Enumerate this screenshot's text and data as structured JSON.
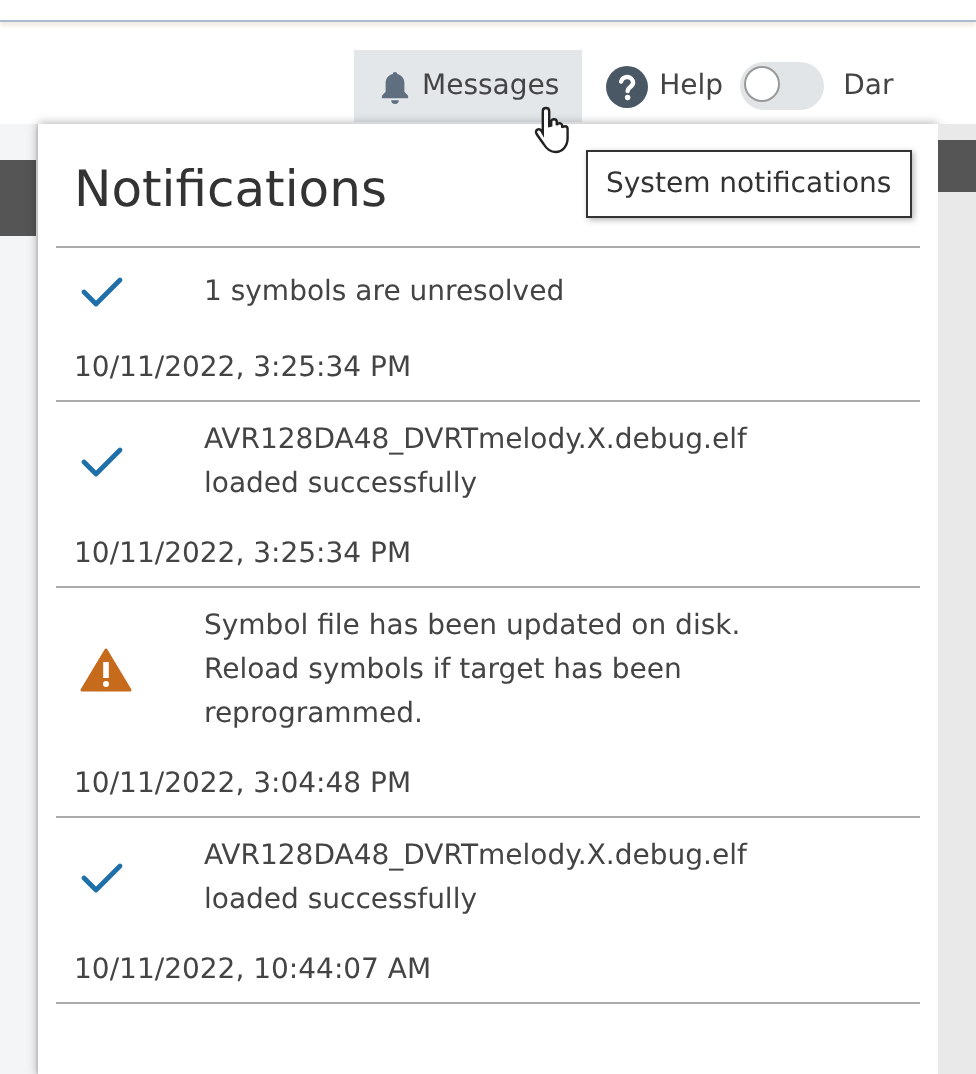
{
  "toolbar": {
    "messages_button": {
      "label": "Messages",
      "selected": true
    },
    "help_button": {
      "label": "Help"
    },
    "dark_toggle": {
      "label": "Dar",
      "on": false
    }
  },
  "tooltip": "System notifications",
  "notifications": {
    "title": "Notifications",
    "items": [
      {
        "kind": "success",
        "message": "1 symbols are unresolved",
        "time": "10/11/2022, 3:25:34 PM"
      },
      {
        "kind": "success",
        "message": "AVR128DA48_DVRTmelody.X.debug.elf loaded successfully",
        "time": "10/11/2022, 3:25:34 PM"
      },
      {
        "kind": "warning",
        "message": "Symbol file has been updated on disk. Reload symbols if target has been reprogrammed.",
        "time": "10/11/2022, 3:04:48 PM"
      },
      {
        "kind": "success",
        "message": "AVR128DA48_DVRTmelody.X.debug.elf loaded successfully",
        "time": "10/11/2022, 10:44:07 AM"
      }
    ]
  }
}
